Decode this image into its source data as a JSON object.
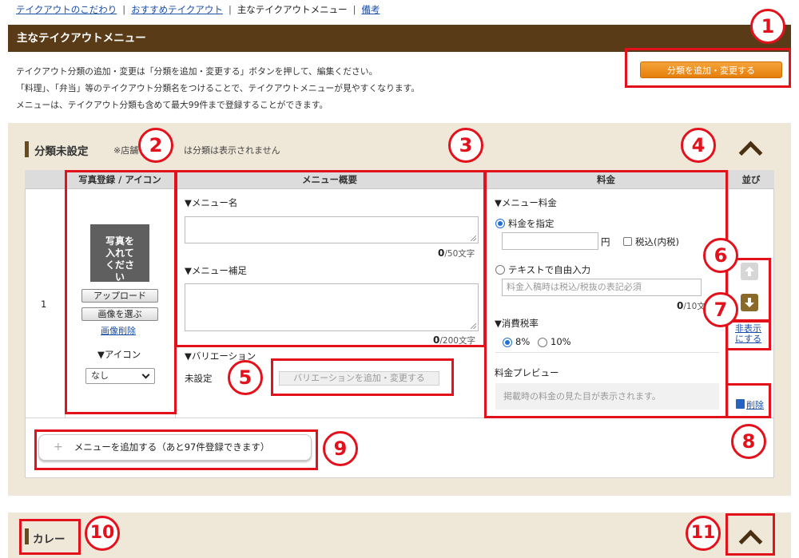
{
  "breadcrumb": {
    "items": [
      "テイクアウトのこだわり",
      "おすすめテイクアウト",
      "主なテイクアウトメニュー",
      "備考"
    ]
  },
  "page_title": "主なテイクアウトメニュー",
  "intro": {
    "line1": "テイクアウト分類の追加・変更は「分類を追加・変更する」ボタンを押して、編集ください。",
    "line2": "「料理」、「弁当」等のテイクアウト分類名をつけることで、テイクアウトメニューが見やすくなります。",
    "line3": "メニューは、テイクアウト分類も含めて最大99件まで登録することができます。"
  },
  "add_category_button": "分類を追加・変更する",
  "section1": {
    "title": "分類未設定",
    "note_prefix": "※店舗",
    "note_suffix": "は分類は表示されません",
    "columns": {
      "photo": "写真登録 / アイコン",
      "overview": "メニュー概要",
      "price": "料金",
      "order": "並び"
    },
    "row_number": "1",
    "photo": {
      "placeholder": "写真を入れてください",
      "upload": "アップロード",
      "choose": "画像を選ぶ",
      "delete": "画像削除",
      "icon_label": "▼アイコン",
      "icon_value": "なし"
    },
    "overview": {
      "name_label": "▼メニュー名",
      "name_count": "0",
      "name_max": "/50文字",
      "supplement_label": "▼メニュー補足",
      "supplement_count": "0",
      "supplement_max": "/200文字",
      "variation_label": "▼バリエーション",
      "variation_value": "未設定",
      "variation_button": "バリエーションを追加・変更する"
    },
    "price": {
      "menu_price_label": "▼メニュー料金",
      "option_specify": "料金を指定",
      "yen": "円",
      "tax_included": "税込(内税)",
      "option_free_text": "テキストで自由入力",
      "free_text_placeholder": "料金入稿時は税込/税抜の表記必須",
      "free_text_count": "0",
      "free_text_max": "/10文",
      "tax_rate_label": "▼消費税率",
      "tax_8": "8%",
      "tax_10": "10%",
      "preview_label": "料金プレビュー",
      "preview_placeholder": "掲載時の料金の見た目が表示されます。"
    },
    "order": {
      "hide_link_line1": "非表示",
      "hide_link_line2": "にする",
      "delete": "削除"
    },
    "add_menu_button": "メニューを追加する（あと97件登録できます）"
  },
  "section2": {
    "title": "カレー"
  },
  "annotations": [
    "1",
    "2",
    "3",
    "4",
    "5",
    "6",
    "7",
    "8",
    "9",
    "10",
    "11"
  ],
  "colors": {
    "title_bar": "#5a3b17",
    "section_bg": "#efe8d8",
    "annotation_red": "#e3111b",
    "orange_button": "#e67e0a",
    "link_blue": "#1a4fa8"
  }
}
